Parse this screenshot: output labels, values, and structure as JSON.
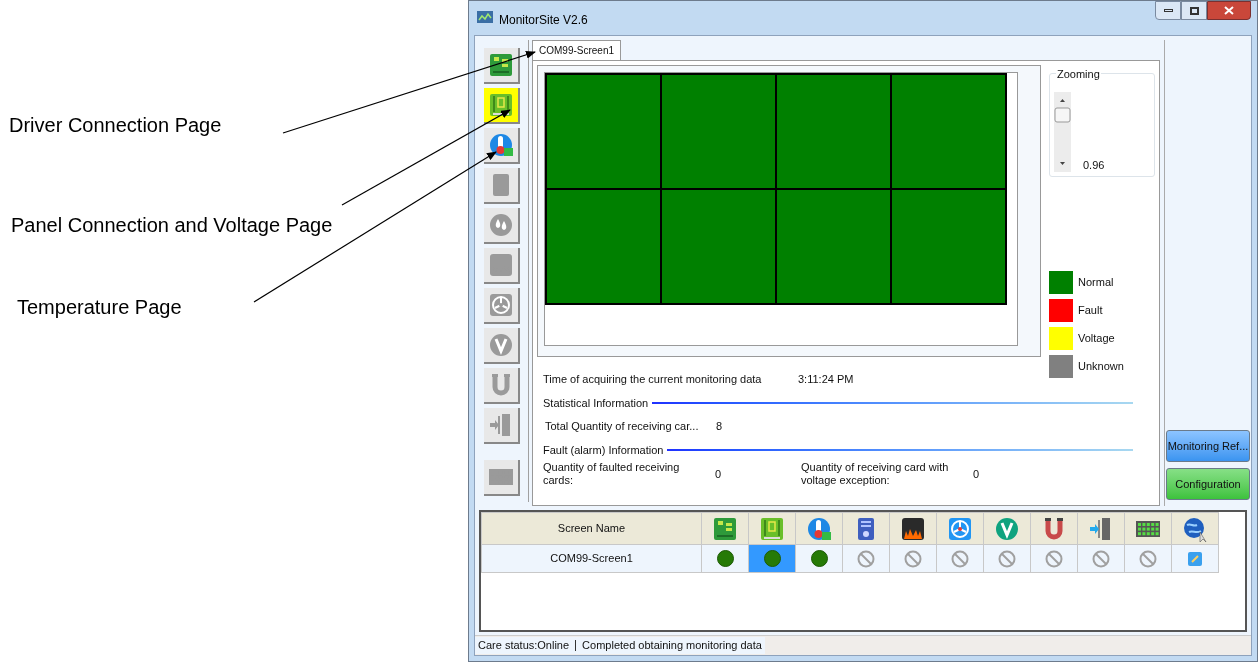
{
  "annotations": [
    {
      "text": "Driver Connection Page"
    },
    {
      "text": "Panel Connection and Voltage Page"
    },
    {
      "text": "Temperature Page"
    }
  ],
  "window": {
    "title": "MonitorSite V2.6"
  },
  "side_icons": [
    {
      "kind": "board",
      "selected": false,
      "enabled": true
    },
    {
      "kind": "panel",
      "selected": true,
      "enabled": true
    },
    {
      "kind": "thermo",
      "selected": false,
      "enabled": true
    },
    {
      "kind": "card",
      "selected": false,
      "enabled": false
    },
    {
      "kind": "drop",
      "selected": false,
      "enabled": false
    },
    {
      "kind": "fire",
      "selected": false,
      "enabled": false
    },
    {
      "kind": "fan",
      "selected": false,
      "enabled": false
    },
    {
      "kind": "v",
      "selected": false,
      "enabled": false
    },
    {
      "kind": "cable",
      "selected": false,
      "enabled": false
    },
    {
      "kind": "door",
      "selected": false,
      "enabled": false
    },
    {
      "kind": "grid",
      "selected": false,
      "enabled": false
    }
  ],
  "tabs": [
    {
      "label": "COM99-Screen1",
      "selected": true
    }
  ],
  "cells": [
    {
      "color": "#008000"
    },
    {
      "color": "#008000"
    },
    {
      "color": "#008000"
    },
    {
      "color": "#008000"
    },
    {
      "color": "#008000"
    },
    {
      "color": "#008000"
    },
    {
      "color": "#008000"
    },
    {
      "color": "#008000"
    }
  ],
  "zooming": {
    "title": "Zooming",
    "value": "0.96"
  },
  "legend": [
    {
      "label": "Normal",
      "color": "#008000"
    },
    {
      "label": "Fault",
      "color": "#ff0000"
    },
    {
      "label": "Voltage",
      "color": "#ffff00"
    },
    {
      "label": "Unknown",
      "color": "#808080"
    }
  ],
  "time": {
    "label": "Time of acquiring the current monitoring data",
    "value": "3:11:24 PM"
  },
  "statistical": {
    "title": "Statistical Information",
    "label": "Total Quantity of receiving car...",
    "value": "8"
  },
  "fault": {
    "title": "Fault (alarm) Information",
    "items": [
      {
        "label": "Quantity of faulted receiving cards:",
        "value": "0"
      },
      {
        "label": "Quantity of receiving card with voltage exception:",
        "value": "0"
      }
    ]
  },
  "buttons": [
    {
      "label": "Monitoring Ref...",
      "kind": "blue"
    },
    {
      "label": "Configuration",
      "kind": "green"
    }
  ],
  "table": {
    "columns": [
      {
        "kind": "text",
        "label": "Screen Name"
      },
      {
        "kind": "board"
      },
      {
        "kind": "panel"
      },
      {
        "kind": "thermo"
      },
      {
        "kind": "card"
      },
      {
        "kind": "fire"
      },
      {
        "kind": "fan"
      },
      {
        "kind": "v"
      },
      {
        "kind": "cable"
      },
      {
        "kind": "door"
      },
      {
        "kind": "grid"
      },
      {
        "kind": "globe"
      }
    ],
    "rows": [
      {
        "name": "COM99-Screen1",
        "cells": [
          {
            "kind": "dot",
            "selected": false
          },
          {
            "kind": "dot",
            "selected": true
          },
          {
            "kind": "dot",
            "selected": false
          },
          {
            "kind": "blocked",
            "selected": false
          },
          {
            "kind": "blocked",
            "selected": false
          },
          {
            "kind": "blocked",
            "selected": false
          },
          {
            "kind": "blocked",
            "selected": false
          },
          {
            "kind": "blocked",
            "selected": false
          },
          {
            "kind": "blocked",
            "selected": false
          },
          {
            "kind": "blocked",
            "selected": false
          },
          {
            "kind": "edit",
            "selected": false
          }
        ]
      }
    ]
  },
  "status_bar": {
    "items": [
      {
        "text": "Care status:Online"
      },
      {
        "text": "Completed obtaining monitoring data"
      }
    ]
  }
}
